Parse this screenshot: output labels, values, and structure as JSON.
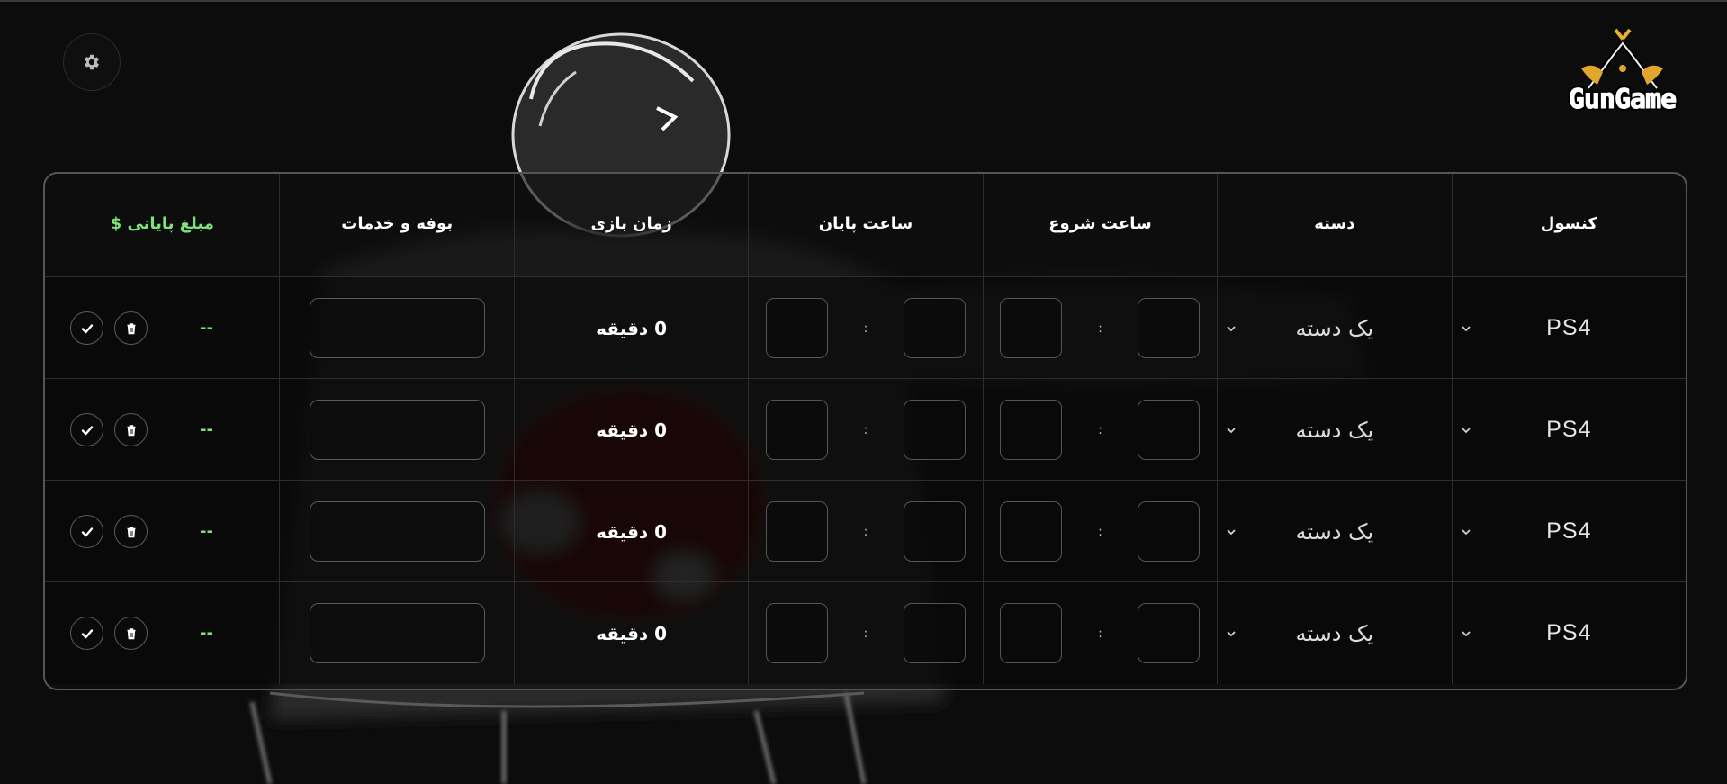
{
  "brand": {
    "logo_text": "GunGame"
  },
  "icons": {
    "settings": "gear-icon",
    "confirm": "check-icon",
    "delete": "trash-icon",
    "dropdown": "chevron-down-icon"
  },
  "colors": {
    "accent_green": "#7ee27a",
    "background": "#0c0c0c"
  },
  "table": {
    "headers": {
      "console": "کنسول",
      "controller": "دسته",
      "start_time": "ساعت شروع",
      "end_time": "ساعت پایان",
      "play_time": "زمان بازی",
      "services": "بوفه و خدمات",
      "final_amount": "مبلغ پایانی $"
    },
    "time_separator": ":",
    "rows": [
      {
        "console": "PS4",
        "controller": "یک دسته",
        "start_hour": "",
        "start_minute": "",
        "end_hour": "",
        "end_minute": "",
        "play_time": "0 دقیقه",
        "services": "",
        "final_amount": "--"
      },
      {
        "console": "PS4",
        "controller": "یک دسته",
        "start_hour": "",
        "start_minute": "",
        "end_hour": "",
        "end_minute": "",
        "play_time": "0 دقیقه",
        "services": "",
        "final_amount": "--"
      },
      {
        "console": "PS4",
        "controller": "یک دسته",
        "start_hour": "",
        "start_minute": "",
        "end_hour": "",
        "end_minute": "",
        "play_time": "0 دقیقه",
        "services": "",
        "final_amount": "--"
      },
      {
        "console": "PS4",
        "controller": "یک دسته",
        "start_hour": "",
        "start_minute": "",
        "end_hour": "",
        "end_minute": "",
        "play_time": "0 دقیقه",
        "services": "",
        "final_amount": "--"
      }
    ]
  }
}
